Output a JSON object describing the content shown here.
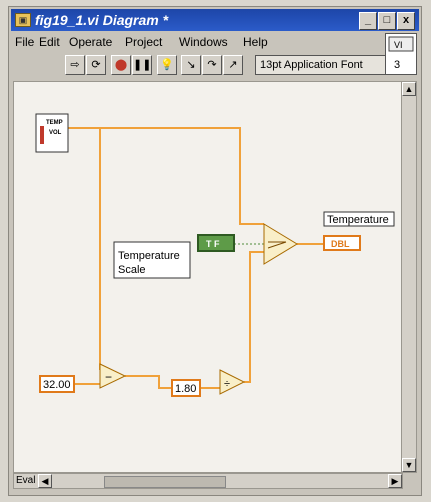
{
  "window": {
    "title": "fig19_1.vi Diagram *"
  },
  "window_controls": {
    "minimize": "_",
    "maximize": "□",
    "close": "x"
  },
  "menu": [
    "File",
    "Edit",
    "Operate",
    "Project",
    "Windows",
    "Help"
  ],
  "toolbar": {
    "font": "13pt Application Font",
    "help_number": "3"
  },
  "diagram": {
    "temp_icon_label": [
      "TEMP",
      "VOL"
    ],
    "scale_label": [
      "Temperature",
      "Scale"
    ],
    "bool_constant": "T F",
    "indicator_label": "Temperature",
    "indicator_type": "DBL",
    "constant_32": "32.00",
    "constant_18": "1.80",
    "subtract_symbol": "−",
    "divide_symbol": "÷"
  },
  "scroll": {
    "eval_label": "Eval"
  },
  "colors": {
    "wire": "#f0a13a",
    "bool_wire": "#4f8a3a",
    "indicator_border": "#e07a1a"
  }
}
